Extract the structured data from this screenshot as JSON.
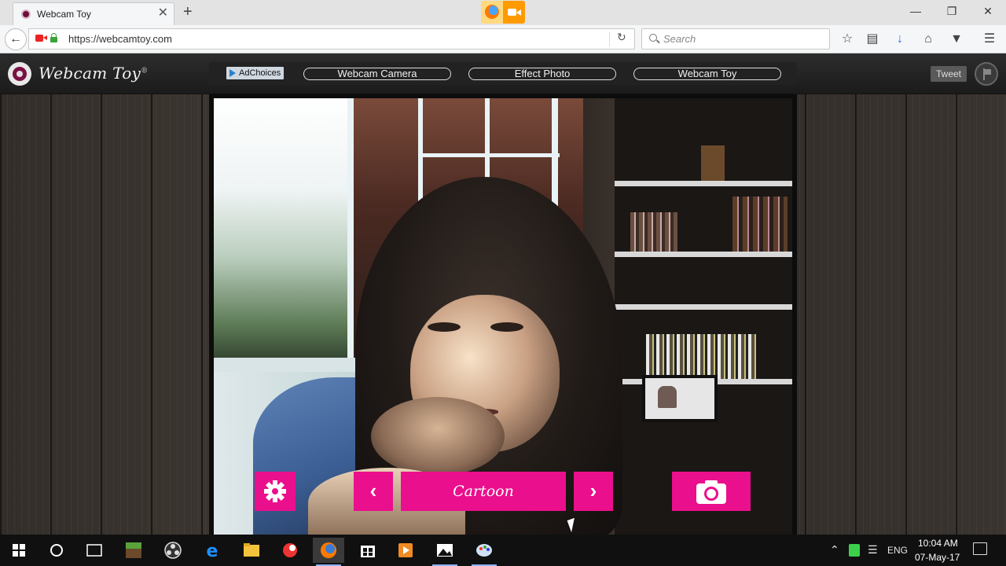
{
  "browser": {
    "tab": {
      "title": "Webcam Toy",
      "close": "✕"
    },
    "new_tab": "+",
    "window_controls": {
      "minimize": "—",
      "restore": "❐",
      "close": "✕"
    },
    "url": "https://webcamtoy.com",
    "search_placeholder": "Search",
    "toolbar_icons": [
      "star-icon",
      "reading-list-icon",
      "download-icon",
      "home-icon",
      "pocket-icon",
      "menu-icon"
    ]
  },
  "site": {
    "logo_text": "Webcam Toy",
    "logo_reg": "®",
    "adchoices": "AdChoices",
    "menu": [
      "Webcam Camera",
      "Effect Photo",
      "Webcam Toy"
    ],
    "tweet": "Tweet"
  },
  "camera": {
    "effect_name": "Cartoon",
    "prev": "‹",
    "next": "›"
  },
  "taskbar": {
    "apps": [
      "start-icon",
      "cortana-icon",
      "task-view-icon",
      "minecraft-icon",
      "obs-icon",
      "edge-icon",
      "file-explorer-icon",
      "app-icon",
      "firefox-icon",
      "store-icon",
      "media-player-icon",
      "photos-icon",
      "paint-icon"
    ],
    "language": "ENG",
    "time": "10:04 AM",
    "date": "07-May-17"
  },
  "colors": {
    "accent": "#ea0f8c",
    "header": "#1f1f1f"
  }
}
